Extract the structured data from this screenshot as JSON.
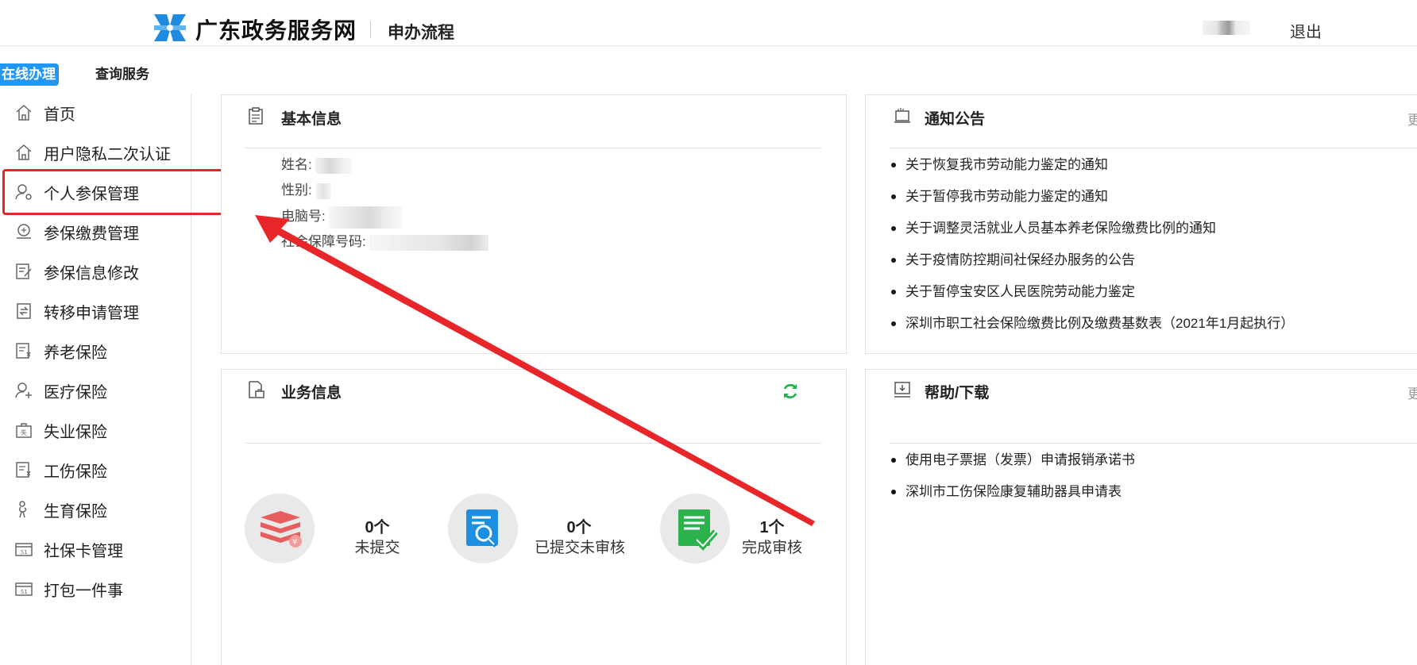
{
  "header": {
    "site_name": "广东政务服务网",
    "process": "申办流程",
    "logout": "退出"
  },
  "tabs": {
    "online": "在线办理",
    "query": "查询服务"
  },
  "sidebar": {
    "items": [
      {
        "label": "首页",
        "icon": "home-icon"
      },
      {
        "label": "用户隐私二次认证",
        "icon": "home-icon"
      },
      {
        "label": "个人参保管理",
        "icon": "person-gear-icon"
      },
      {
        "label": "参保缴费管理",
        "icon": "payment-icon"
      },
      {
        "label": "参保信息修改",
        "icon": "edit-doc-icon"
      },
      {
        "label": "转移申请管理",
        "icon": "transfer-icon"
      },
      {
        "label": "养老保险",
        "icon": "yen-doc-icon"
      },
      {
        "label": "医疗保险",
        "icon": "medical-person-icon"
      },
      {
        "label": "失业保险",
        "icon": "unemployment-icon"
      },
      {
        "label": "工伤保险",
        "icon": "yen-doc-icon"
      },
      {
        "label": "生育保险",
        "icon": "maternity-icon"
      },
      {
        "label": "社保卡管理",
        "icon": "card-icon"
      },
      {
        "label": "打包一件事",
        "icon": "card-icon"
      }
    ]
  },
  "basic_info": {
    "title": "基本信息",
    "fields": [
      {
        "label": "姓名:"
      },
      {
        "label": "性别:"
      },
      {
        "label": "电脑号:"
      },
      {
        "label": "社会保障号码:"
      }
    ]
  },
  "notices": {
    "title": "通知公告",
    "more": "更",
    "items": [
      "关于恢复我市劳动能力鉴定的通知",
      "关于暂停我市劳动能力鉴定的通知",
      "关于调整灵活就业人员基本养老保险缴费比例的通知",
      "关于疫情防控期间社保经办服务的公告",
      "关于暂停宝安区人民医院劳动能力鉴定",
      "深圳市职工社会保险缴费比例及缴费基数表（2021年1月起执行）"
    ]
  },
  "business": {
    "title": "业务信息",
    "stats": [
      {
        "count": "0个",
        "label": "未提交",
        "icon": "stack-icon"
      },
      {
        "count": "0个",
        "label": "已提交未审核",
        "icon": "search-doc-icon"
      },
      {
        "count": "1个",
        "label": "完成审核",
        "icon": "approved-doc-icon"
      }
    ]
  },
  "help": {
    "title": "帮助/下载",
    "more": "更",
    "items": [
      "使用电子票据（发票）申请报销承诺书",
      "深圳市工伤保险康复辅助器具申请表"
    ]
  },
  "colors": {
    "accent": "#2196f3",
    "highlight": "#e8262a",
    "refresh": "#19b24b"
  }
}
